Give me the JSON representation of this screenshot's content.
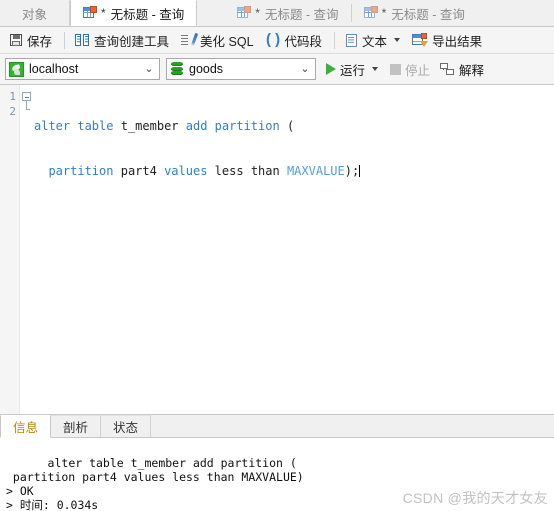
{
  "window": {
    "app": "Navicat Query Editor"
  },
  "tabbar": {
    "object_tab": "对象",
    "tabs": [
      {
        "star": "*",
        "label": "无标题 - 查询",
        "active": true,
        "icon": "query-grid-icon"
      },
      {
        "star": "*",
        "label": "无标题 - 查询",
        "active": false,
        "icon": "query-grid-icon"
      },
      {
        "star": "*",
        "label": "无标题 - 查询",
        "active": false,
        "icon": "query-grid-icon"
      }
    ]
  },
  "toolbar": {
    "save": "保存",
    "query_builder": "查询创建工具",
    "beautify_sql": "美化 SQL",
    "code_snippet": "代码段",
    "text": "文本",
    "export_result": "导出结果"
  },
  "connbar": {
    "connection": "localhost",
    "database": "goods",
    "run": "运行",
    "stop": "停止",
    "explain": "解释"
  },
  "editor": {
    "lines": [
      "1",
      "2"
    ],
    "line1": {
      "kw_alter": "alter",
      "kw_table": "table",
      "id_table": "t_member",
      "kw_add": "add",
      "kw_partition": "partition",
      "paren": "("
    },
    "line2": {
      "kw_partition": "partition",
      "id_name": "part4",
      "kw_values": "values",
      "kw_less": "less",
      "kw_than": "than",
      "kw_maxvalue": "MAXVALUE",
      "tail": ");"
    },
    "colors": {
      "keyword": "#2f7fd0",
      "builtin": "#4f9fe0",
      "identifier": "#202020",
      "linenumber": "#7a93b5"
    }
  },
  "bottom": {
    "tabs": [
      {
        "label": "信息",
        "active": true
      },
      {
        "label": "剖析",
        "active": false
      },
      {
        "label": "状态",
        "active": false
      }
    ],
    "log": "alter table t_member add partition (\n partition part4 values less than MAXVALUE)\n> OK\n> 时间: 0.034s",
    "watermark": "CSDN @我的天才女友"
  }
}
